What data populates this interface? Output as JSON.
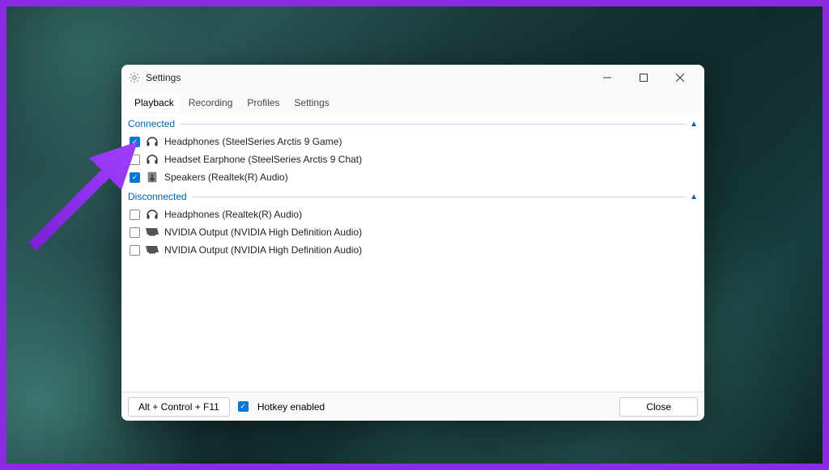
{
  "window": {
    "title": "Settings"
  },
  "tabs": [
    {
      "label": "Playback",
      "active": true
    },
    {
      "label": "Recording",
      "active": false
    },
    {
      "label": "Profiles",
      "active": false
    },
    {
      "label": "Settings",
      "active": false
    }
  ],
  "groups": [
    {
      "title": "Connected",
      "devices": [
        {
          "checked": true,
          "icon": "headphones",
          "label": "Headphones (SteelSeries Arctis 9 Game)"
        },
        {
          "checked": false,
          "icon": "headphones",
          "label": "Headset Earphone (SteelSeries Arctis 9 Chat)"
        },
        {
          "checked": true,
          "icon": "speaker",
          "label": "Speakers (Realtek(R) Audio)"
        }
      ]
    },
    {
      "title": "Disconnected",
      "devices": [
        {
          "checked": false,
          "icon": "headphones",
          "label": "Headphones (Realtek(R) Audio)"
        },
        {
          "checked": false,
          "icon": "monitor",
          "label": "NVIDIA Output (NVIDIA High Definition Audio)"
        },
        {
          "checked": false,
          "icon": "monitor",
          "label": "NVIDIA Output (NVIDIA High Definition Audio)"
        }
      ]
    }
  ],
  "footer": {
    "hotkey": "Alt + Control + F11",
    "hotkey_enabled_label": "Hotkey enabled",
    "hotkey_enabled_checked": true,
    "close_label": "Close"
  }
}
